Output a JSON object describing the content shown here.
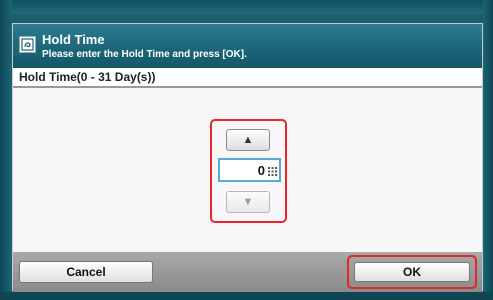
{
  "dialog": {
    "title": "Hold Time",
    "subtitle": "Please enter the Hold Time and press [OK].",
    "field_label": "Hold Time(0 - 31 Day(s))"
  },
  "stepper": {
    "up_glyph": "▲",
    "down_glyph": "▼",
    "value": "0"
  },
  "footer": {
    "cancel_label": "Cancel",
    "ok_label": "OK"
  },
  "colors": {
    "titlebar": "#1c6679",
    "highlight": "#e5242b",
    "field_border": "#5aa8d8"
  },
  "icons": [
    "hold-time-icon",
    "keypad-icon",
    "up-arrow-icon",
    "down-arrow-icon"
  ]
}
